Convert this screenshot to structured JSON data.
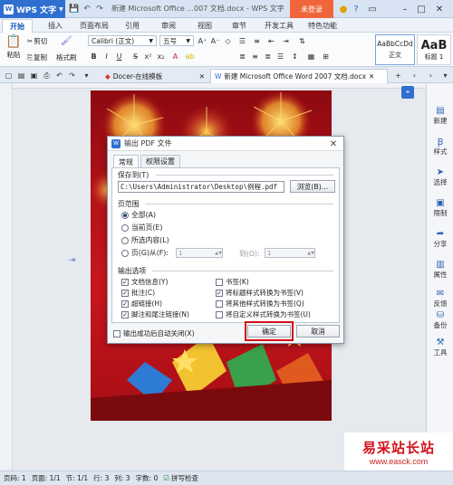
{
  "titlebar": {
    "app_name": "WPS 文字",
    "window_title": "新建 Microsoft Office ...007 文档.docx - WPS 文字",
    "login_label": "未登录"
  },
  "menubar": {
    "tabs": [
      "开始",
      "插入",
      "页面布局",
      "引用",
      "审阅",
      "视图",
      "章节",
      "开发工具",
      "特色功能"
    ]
  },
  "ribbon": {
    "cut_label": "剪切",
    "paste_label": "粘贴",
    "copy_label": "复制",
    "format_painter_label": "格式刷",
    "font_name": "Calibri (正文)",
    "font_size": "五号",
    "bold": "B",
    "italic": "I",
    "underline": "U",
    "style_normal_sample": "AaBbCcDd",
    "style_normal_label": "正文",
    "style_h1_sample": "AaB",
    "style_h1_label": "标题 1"
  },
  "doctabs": {
    "tab1": "Docer-在线模板",
    "tab2": "新建 Microsoft Office Word 2007 文档.docx",
    "add": "+"
  },
  "rightpanel": {
    "items": [
      "新建",
      "样式",
      "选择",
      "限制",
      "分享",
      "属性",
      "反馈",
      "备份",
      "工具"
    ]
  },
  "dialog": {
    "title": "输出 PDF 文件",
    "tab_normal": "常规",
    "tab_permissions": "权限设置",
    "save_to_label": "保存到(T)",
    "path_value": "C:\\Users\\Administrator\\Desktop\\例程.pdf",
    "browse_label": "浏览(B)...",
    "page_range_label": "页范围",
    "range_all": "全部(A)",
    "range_current": "当前页(E)",
    "range_selection": "所选内容(L)",
    "range_pages": "页(G)从(F):",
    "from_value": "1",
    "to_label": "到(O):",
    "to_value": "1",
    "output_options_label": "输出选项",
    "opt_doc_info": "文档信息(Y)",
    "opt_comments": "批注(C)",
    "opt_hyperlinks": "超链接(H)",
    "opt_footnotes": "脚注和尾注链接(N)",
    "opt_bookmarks": "书签(K)",
    "opt_heading_bookmarks": "将标题样式转换为书签(V)",
    "opt_other_bookmarks": "将其他样式转换为书签(Q)",
    "opt_custom_bookmarks": "将自定义样式转换为书签(U)",
    "auto_close_label": "输出成功后自动关闭(X)",
    "ok_label": "确定",
    "cancel_label": "取消"
  },
  "statusbar": {
    "page_num": "页码: 1",
    "page_count": "页面: 1/1",
    "section": "节: 1/1",
    "row": "行: 3",
    "col": "列: 3",
    "word_count": "字数: 0",
    "spell_check": "拼写检查"
  },
  "watermark": {
    "line1": "易采站长站",
    "line2": "www.easck.com"
  }
}
